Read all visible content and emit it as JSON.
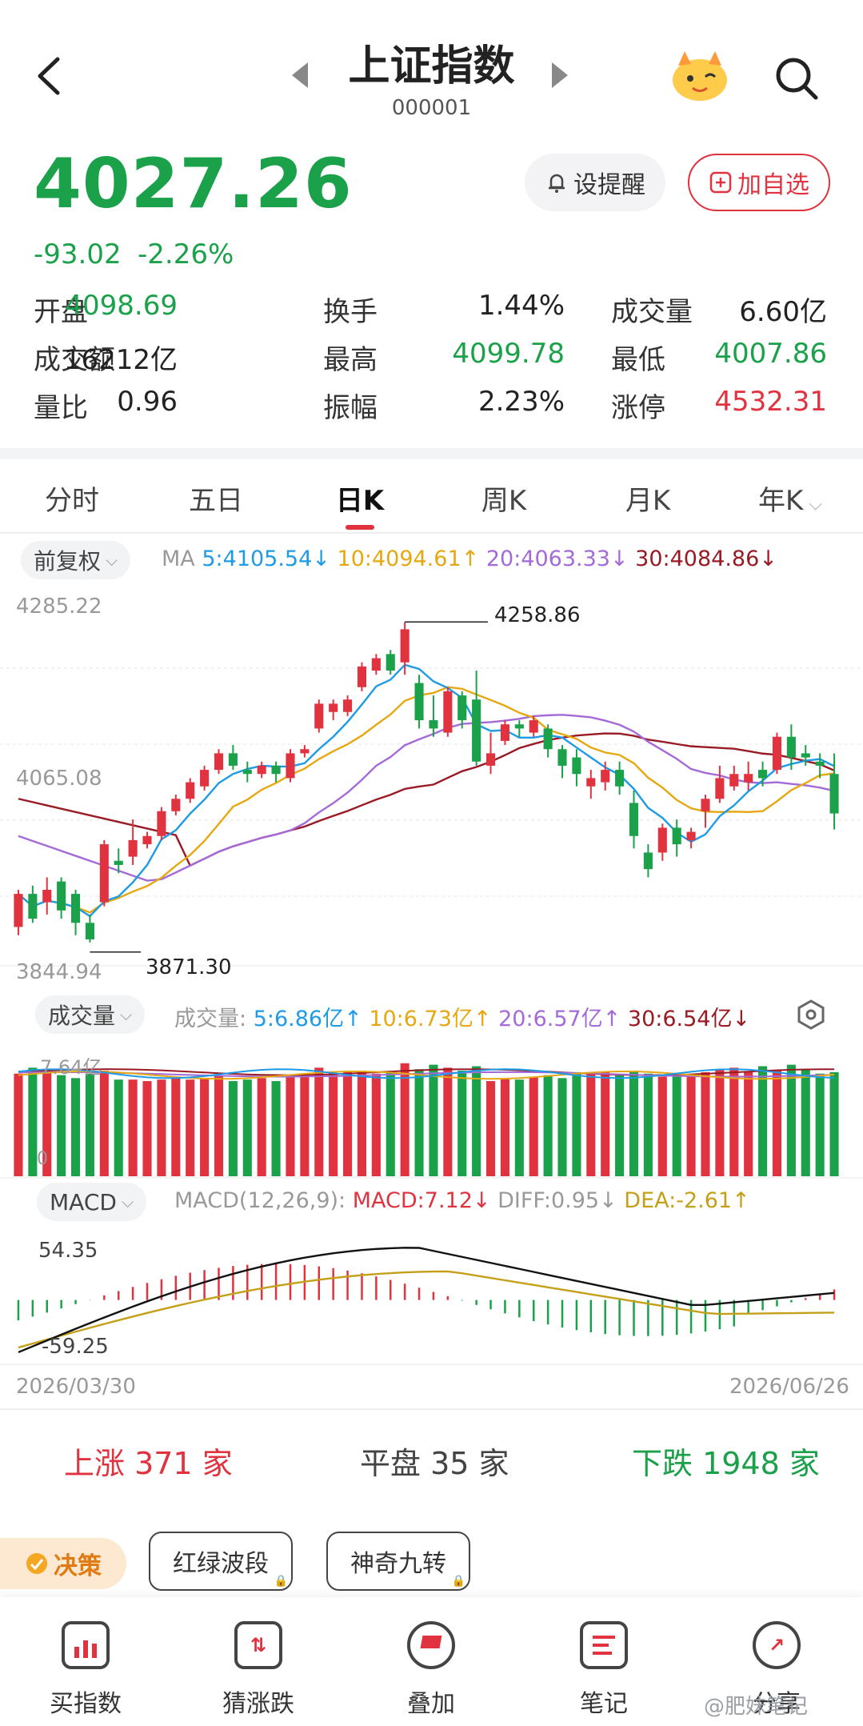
{
  "header": {
    "title": "上证指数",
    "code": "000001"
  },
  "quote": {
    "price": "4027.26",
    "change": "-93.02",
    "change_pct": "-2.26%",
    "alert_label": "设提醒",
    "add_label": "加自选"
  },
  "stats": [
    {
      "label": "开盘",
      "value": "4098.69",
      "color": "green"
    },
    {
      "label": "换手",
      "value": "1.44%",
      "color": "dark"
    },
    {
      "label": "成交量",
      "value": "6.60亿",
      "color": "dark"
    },
    {
      "label": "成交额",
      "value": "16212亿",
      "color": "dark"
    },
    {
      "label": "最高",
      "value": "4099.78",
      "color": "green"
    },
    {
      "label": "最低",
      "value": "4007.86",
      "color": "green"
    },
    {
      "label": "量比",
      "value": "0.96",
      "color": "dark"
    },
    {
      "label": "振幅",
      "value": "2.23%",
      "color": "dark"
    },
    {
      "label": "涨停",
      "value": "4532.31",
      "color": "red"
    }
  ],
  "tabs": [
    "分时",
    "五日",
    "日K",
    "周K",
    "月K",
    "年K"
  ],
  "active_tab": "日K",
  "ma_bar": {
    "adjust": "前复权",
    "ma_label": "MA",
    "ma5": "5:4105.54↓",
    "ma10": "10:4094.61↑",
    "ma20": "20:4063.33↓",
    "ma30": "30:4084.86↓"
  },
  "price_axis": {
    "top": "4285.22",
    "mid": "4065.08",
    "bottom": "3844.94"
  },
  "annotations": {
    "high": "4258.86",
    "low": "3871.30"
  },
  "volume_bar": {
    "chip": "成交量",
    "label": "成交量:",
    "ma5": "5:6.86亿↑",
    "ma10": "10:6.73亿↑",
    "ma20": "20:6.57亿↑",
    "ma30": "30:6.54亿↓",
    "axis_top": "7.64亿",
    "axis_zero": "0"
  },
  "macd_bar": {
    "chip": "MACD",
    "params": "MACD(12,26,9):",
    "macd": "MACD:7.12↓",
    "diff": "DIFF:0.95↓",
    "dea": "DEA:-2.61↑",
    "axis_top": "54.35",
    "axis_bottom": "-59.25"
  },
  "dates": {
    "start": "2026/03/30",
    "end": "2026/06/26"
  },
  "market_breadth": {
    "up": "上涨 371 家",
    "flat": "平盘 35 家",
    "down": "下跌 1948 家"
  },
  "tools": {
    "decision": "决策",
    "tool1": "红绿波段",
    "tool2": "神奇九转"
  },
  "nav": [
    "买指数",
    "猜涨跌",
    "叠加",
    "笔记",
    "分享"
  ],
  "watermark": "@肥妹笔记",
  "colors": {
    "up": "#e0333f",
    "down": "#1aa14a",
    "ma5": "#1e9be6",
    "ma10": "#e6a812",
    "ma20": "#a46ad8",
    "ma30": "#9a1a24",
    "dif": "#111111",
    "dea": "#c4a019"
  },
  "chart_data": {
    "type": "candlestick",
    "ylim": [
      3844.94,
      4285.22
    ],
    "volume_max": 7.64,
    "macd_ylim": [
      -59.25,
      54.35
    ],
    "x_start": "2026/03/30",
    "x_end": "2026/06/26",
    "candles": [
      [
        3890,
        3930,
        3880,
        3935
      ],
      [
        3930,
        3900,
        3895,
        3940
      ],
      [
        3920,
        3935,
        3905,
        3950
      ],
      [
        3945,
        3910,
        3900,
        3950
      ],
      [
        3930,
        3895,
        3880,
        3935
      ],
      [
        3895,
        3875,
        3871.3,
        3905
      ],
      [
        3920,
        3990,
        3915,
        3995
      ],
      [
        3970,
        3965,
        3955,
        3985
      ],
      [
        3975,
        3995,
        3965,
        4020
      ],
      [
        3990,
        4000,
        3985,
        4005
      ],
      [
        4000,
        4030,
        3995,
        4035
      ],
      [
        4030,
        4045,
        4025,
        4050
      ],
      [
        4045,
        4065,
        4040,
        4070
      ],
      [
        4060,
        4080,
        4055,
        4085
      ],
      [
        4080,
        4100,
        4075,
        4105
      ],
      [
        4100,
        4085,
        4080,
        4110
      ],
      [
        4080,
        4075,
        4065,
        4090
      ],
      [
        4075,
        4085,
        4070,
        4090
      ],
      [
        4085,
        4075,
        4065,
        4090
      ],
      [
        4070,
        4100,
        4065,
        4105
      ],
      [
        4100,
        4105,
        4095,
        4110
      ],
      [
        4130,
        4160,
        4125,
        4165
      ],
      [
        4150,
        4160,
        4140,
        4165
      ],
      [
        4150,
        4165,
        4145,
        4170
      ],
      [
        4180,
        4205,
        4175,
        4210
      ],
      [
        4200,
        4215,
        4195,
        4220
      ],
      [
        4220,
        4200,
        4195,
        4225
      ],
      [
        4210,
        4250,
        4195,
        4258.86
      ],
      [
        4185,
        4140,
        4130,
        4195
      ],
      [
        4140,
        4130,
        4120,
        4170
      ],
      [
        4125,
        4175,
        4120,
        4180
      ],
      [
        4170,
        4140,
        4130,
        4175
      ],
      [
        4165,
        4090,
        4085,
        4200
      ],
      [
        4085,
        4100,
        4075,
        4125
      ],
      [
        4115,
        4135,
        4110,
        4140
      ],
      [
        4135,
        4130,
        4120,
        4140
      ],
      [
        4125,
        4140,
        4120,
        4145
      ],
      [
        4130,
        4105,
        4095,
        4135
      ],
      [
        4105,
        4085,
        4070,
        4110
      ],
      [
        4095,
        4075,
        4060,
        4105
      ],
      [
        4060,
        4070,
        4045,
        4080
      ],
      [
        4065,
        4080,
        4055,
        4090
      ],
      [
        4080,
        4060,
        4050,
        4090
      ],
      [
        4040,
        4000,
        3985,
        4055
      ],
      [
        3980,
        3960,
        3950,
        3990
      ],
      [
        3980,
        4010,
        3970,
        4015
      ],
      [
        4010,
        3990,
        3975,
        4020
      ],
      [
        3995,
        4005,
        3985,
        4010
      ],
      [
        4030,
        4045,
        4010,
        4050
      ],
      [
        4045,
        4070,
        4040,
        4085
      ],
      [
        4060,
        4075,
        4055,
        4085
      ],
      [
        4065,
        4075,
        4055,
        4090
      ],
      [
        4080,
        4070,
        4060,
        4090
      ],
      [
        4080,
        4120,
        4075,
        4125
      ],
      [
        4120,
        4095,
        4080,
        4135
      ],
      [
        4100,
        4095,
        4085,
        4110
      ],
      [
        4090,
        4085,
        4070,
        4100
      ],
      [
        4075,
        4027.26,
        4007.86,
        4099.78
      ]
    ]
  }
}
